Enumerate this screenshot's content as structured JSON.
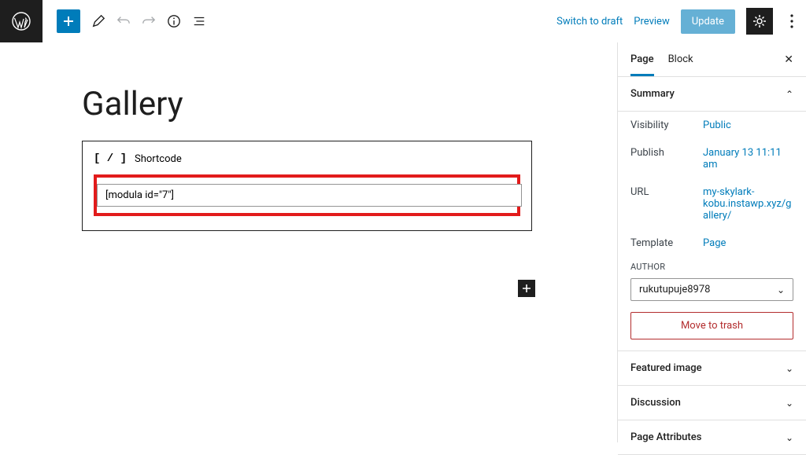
{
  "topbar": {
    "switch_draft": "Switch to draft",
    "preview": "Preview",
    "update": "Update"
  },
  "editor": {
    "title": "Gallery",
    "shortcode_label": "Shortcode",
    "shortcode_value": "[modula id=\"7\"]"
  },
  "sidebar": {
    "tabs": {
      "page": "Page",
      "block": "Block"
    },
    "summary": {
      "title": "Summary",
      "visibility_label": "Visibility",
      "visibility_value": "Public",
      "publish_label": "Publish",
      "publish_value": "January 13 11:11 am",
      "url_label": "URL",
      "url_value": "my-skylark-kobu.instawp.xyz/gallery/",
      "template_label": "Template",
      "template_value": "Page",
      "author_label": "AUTHOR",
      "author_value": "rukutupuje8978",
      "trash": "Move to trash"
    },
    "panels": {
      "featured_image": "Featured image",
      "discussion": "Discussion",
      "page_attributes": "Page Attributes"
    }
  }
}
